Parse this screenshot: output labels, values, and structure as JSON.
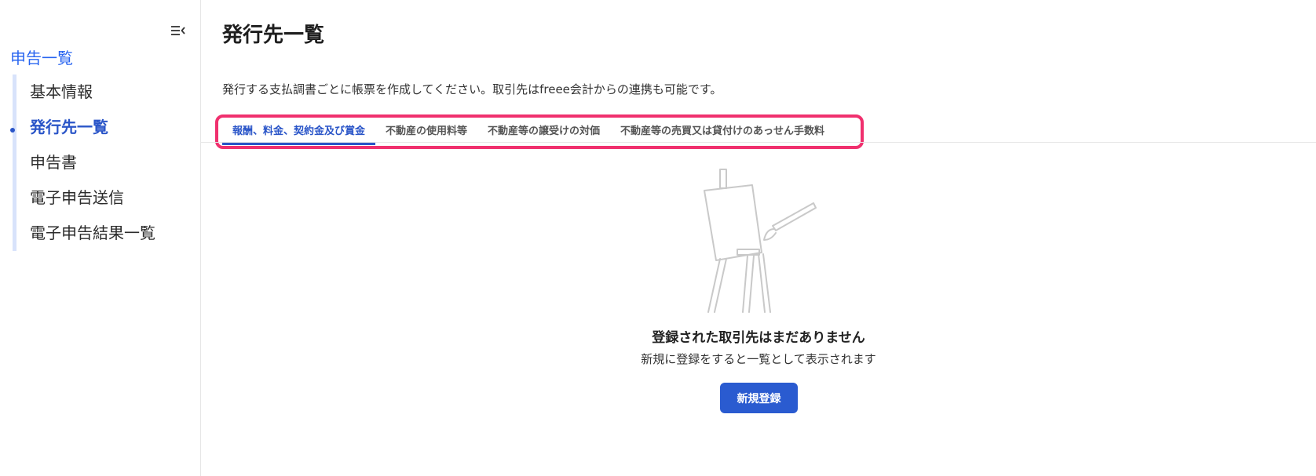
{
  "sidebar": {
    "root_label": "申告一覧",
    "items": [
      {
        "label": "基本情報",
        "active": false
      },
      {
        "label": "発行先一覧",
        "active": true
      },
      {
        "label": "申告書",
        "active": false
      },
      {
        "label": "電子申告送信",
        "active": false
      },
      {
        "label": "電子申告結果一覧",
        "active": false
      }
    ]
  },
  "main": {
    "title": "発行先一覧",
    "description": "発行する支払調書ごとに帳票を作成してください。取引先はfreee会計からの連携も可能です。",
    "tabs": [
      {
        "label": "報酬、料金、契約金及び賞金",
        "active": true
      },
      {
        "label": "不動産の使用料等",
        "active": false
      },
      {
        "label": "不動産等の譲受けの対価",
        "active": false
      },
      {
        "label": "不動産等の売買又は貸付けのあっせん手数料",
        "active": false
      }
    ],
    "empty_state": {
      "title": "登録された取引先はまだありません",
      "subtitle": "新規に登録をすると一覧として表示されます",
      "button_label": "新規登録"
    }
  },
  "colors": {
    "accent": "#2a55c8",
    "button": "#2a5bd0",
    "highlight_border": "#f0306e"
  }
}
